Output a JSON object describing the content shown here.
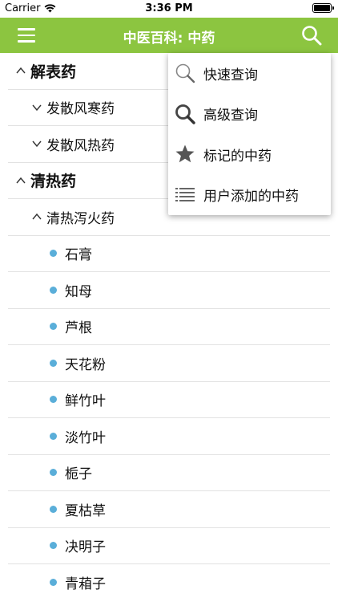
{
  "status_bar": {
    "carrier": "Carrier",
    "time": "3:36 PM"
  },
  "nav": {
    "title": "中医百科: 中药"
  },
  "tree": [
    {
      "label": "解表药",
      "level": 1,
      "expanded": true
    },
    {
      "label": "发散风寒药",
      "level": 2,
      "expanded": false
    },
    {
      "label": "发散风热药",
      "level": 2,
      "expanded": false
    },
    {
      "label": "清热药",
      "level": 1,
      "expanded": true
    },
    {
      "label": "清热泻火药",
      "level": 2,
      "expanded": true
    },
    {
      "label": "石膏",
      "level": 3
    },
    {
      "label": "知母",
      "level": 3
    },
    {
      "label": "芦根",
      "level": 3
    },
    {
      "label": "天花粉",
      "level": 3
    },
    {
      "label": "鲜竹叶",
      "level": 3
    },
    {
      "label": "淡竹叶",
      "level": 3
    },
    {
      "label": "栀子",
      "level": 3
    },
    {
      "label": "夏枯草",
      "level": 3
    },
    {
      "label": "决明子",
      "level": 3
    },
    {
      "label": "青葙子",
      "level": 3
    }
  ],
  "menu": {
    "items": [
      {
        "label": "快速查询",
        "icon": "magnifier-icon"
      },
      {
        "label": "高级查询",
        "icon": "bold-magnifier-icon"
      },
      {
        "label": "标记的中药",
        "icon": "star-icon"
      },
      {
        "label": "用户添加的中药",
        "icon": "list-icon"
      }
    ]
  },
  "colors": {
    "navbar": "#8cc540",
    "dot": "#5aaed9"
  }
}
